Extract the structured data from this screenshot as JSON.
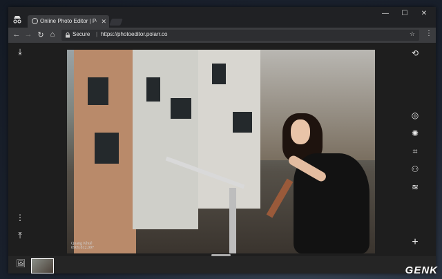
{
  "browser": {
    "tab_title": "Online Photo Editor | Pol",
    "tab_close": "✕",
    "secure_label": "Secure",
    "separator": "|",
    "url": "https://photoeditor.polarr.co",
    "window_controls": {
      "minimize": "—",
      "maximize": "☐",
      "close": "✕"
    },
    "nav": {
      "back": "←",
      "forward": "→",
      "reload": "↻",
      "home": "⌂"
    },
    "star": "☆",
    "menu": "⋮"
  },
  "editor": {
    "left_tools": [
      {
        "icon": "download-icon",
        "glyph": "⤓"
      },
      {
        "icon": "more-vertical-icon",
        "glyph": "⋮"
      },
      {
        "icon": "upload-icon",
        "glyph": "⤒"
      }
    ],
    "right_tools": [
      {
        "icon": "history-icon",
        "glyph": "⟲"
      },
      {
        "icon": "filters-icon",
        "glyph": "◎"
      },
      {
        "icon": "adjust-icon",
        "glyph": "✺"
      },
      {
        "icon": "crop-icon",
        "glyph": "⌗"
      },
      {
        "icon": "retouch-icon",
        "glyph": "⚇"
      },
      {
        "icon": "layers-icon",
        "glyph": "≋"
      },
      {
        "icon": "add-icon",
        "glyph": "+"
      }
    ],
    "photo_credit_name": "Quang Khuê",
    "photo_credit_phone": "0909.812.097",
    "gallery_icon": "🖼"
  },
  "watermark": "GENK"
}
